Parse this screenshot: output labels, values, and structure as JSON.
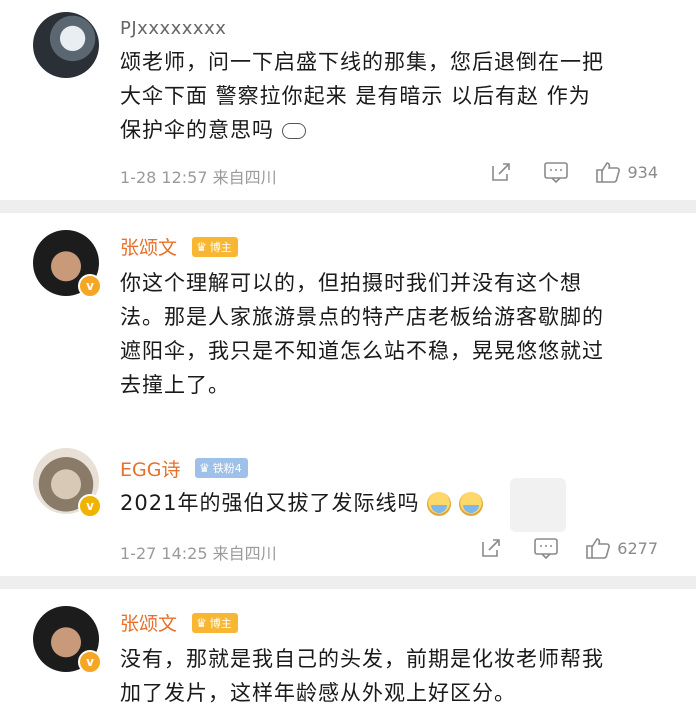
{
  "comments": [
    {
      "username": "PJxxxxxxxx",
      "text_lines": [
        "颂老师，问一下启盛下线的那集，您后退倒在一把",
        "大伞下面 警察拉你起来 是有暗示 以后有赵 作为",
        "保护伞的意思吗"
      ],
      "timestamp": "1-28 12:57",
      "location": "来自四川",
      "likes": "934"
    },
    {
      "username": "张颂文",
      "tag": "博主",
      "text_lines": [
        "你这个理解可以的，但拍摄时我们并没有这个想",
        "法。那是人家旅游景点的特产店老板给游客歇脚的",
        "遮阳伞，我只是不知道怎么站不稳，晃晃悠悠就过",
        "去撞上了。"
      ]
    },
    {
      "username": "EGG诗",
      "tag": "铁粉4",
      "text_lines": [
        "2021年的强伯又拔了发际线吗"
      ],
      "timestamp": "1-27 14:25",
      "location": "来自四川",
      "likes": "6277"
    },
    {
      "username": "张颂文",
      "tag": "博主",
      "text_lines": [
        "没有，那就是我自己的头发，前期是化妆老师帮我",
        "加了发片，这样年龄感从外观上好区分。"
      ]
    }
  ],
  "icons": {
    "share": "share-icon",
    "comment": "comment-icon",
    "like": "like-icon",
    "verified": "verified-badge-icon"
  },
  "colors": {
    "username_highlight": "#e8702a",
    "verified": "#f5a623",
    "divider": "#eeeeee"
  }
}
